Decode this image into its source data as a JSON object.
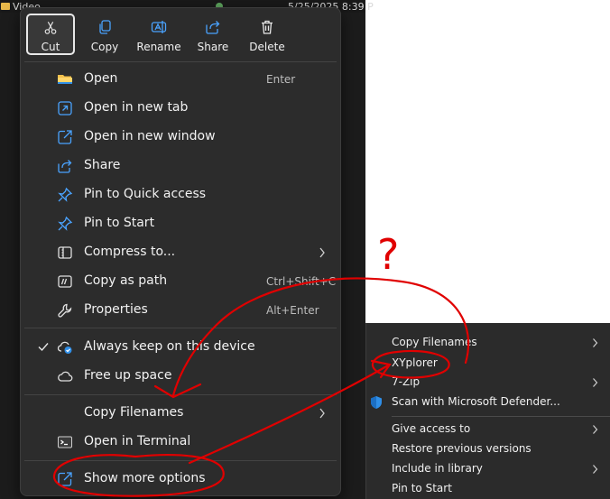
{
  "background_row": {
    "name": "Video",
    "date": "5/25/2025 8:39 P"
  },
  "quick_actions": [
    {
      "label": "Cut",
      "icon": "scissors-icon"
    },
    {
      "label": "Copy",
      "icon": "copy-icon"
    },
    {
      "label": "Rename",
      "icon": "rename-icon"
    },
    {
      "label": "Share",
      "icon": "share-icon"
    },
    {
      "label": "Delete",
      "icon": "trash-icon"
    }
  ],
  "menu": {
    "items": [
      {
        "label": "Open",
        "shortcut": "Enter"
      },
      {
        "label": "Open in new tab"
      },
      {
        "label": "Open in new window"
      },
      {
        "label": "Share"
      },
      {
        "label": "Pin to Quick access"
      },
      {
        "label": "Pin to Start"
      },
      {
        "label": "Compress to..."
      },
      {
        "label": "Copy as path",
        "shortcut": "Ctrl+Shift+C"
      },
      {
        "label": "Properties",
        "shortcut": "Alt+Enter"
      },
      {
        "label": "Always keep on this device"
      },
      {
        "label": "Free up space"
      },
      {
        "label": "Copy Filenames"
      },
      {
        "label": "Open in Terminal"
      },
      {
        "label": "Show more options"
      }
    ]
  },
  "classic_menu": {
    "items": [
      {
        "label": "Copy Filenames"
      },
      {
        "label": "XYplorer"
      },
      {
        "label": "7-Zip"
      },
      {
        "label": "Scan with Microsoft Defender..."
      },
      {
        "label": "Give access to"
      },
      {
        "label": "Restore previous versions"
      },
      {
        "label": "Include in library"
      },
      {
        "label": "Pin to Start"
      }
    ]
  },
  "annotation": {
    "text": "?",
    "color": "#e00000"
  },
  "colors": {
    "menu_bg": "#2c2c2c",
    "accent_blue": "#4aa3ff",
    "folder_yellow": "#f2c04c"
  }
}
